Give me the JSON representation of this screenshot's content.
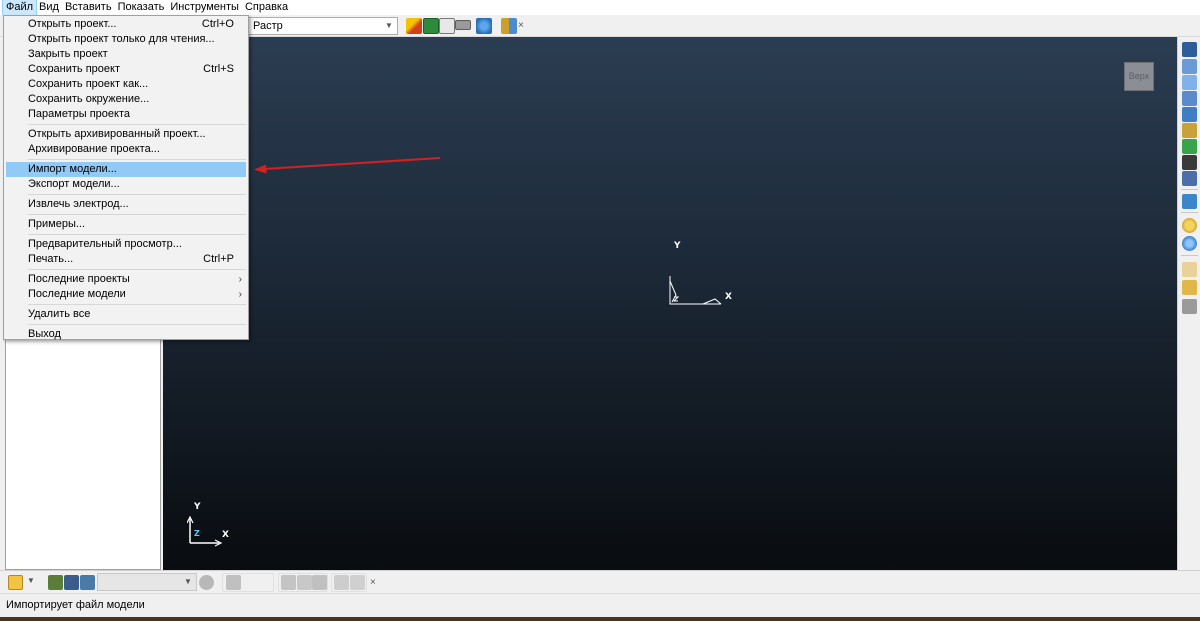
{
  "menubar": {
    "items": [
      "Файл",
      "Вид",
      "Вставить",
      "Показать",
      "Инструменты",
      "Справка"
    ]
  },
  "toolbar": {
    "display_mode": "Растр"
  },
  "viewport": {
    "view_cube_label": "Верх",
    "main_axes": {
      "x": "X",
      "y": "Y",
      "z": "Z"
    },
    "corner_axes": {
      "x": "X",
      "y": "Y",
      "z": "Z"
    }
  },
  "file_menu": {
    "groups": [
      [
        {
          "label": "Открыть проект...",
          "shortcut": "Ctrl+O"
        },
        {
          "label": "Открыть проект только для чтения..."
        },
        {
          "label": "Закрыть проект"
        },
        {
          "label": "Сохранить проект",
          "shortcut": "Ctrl+S"
        },
        {
          "label": "Сохранить проект как..."
        },
        {
          "label": "Сохранить окружение..."
        },
        {
          "label": "Параметры проекта"
        }
      ],
      [
        {
          "label": "Открыть архивированный проект..."
        },
        {
          "label": "Архивирование проекта..."
        }
      ],
      [
        {
          "label": "Импорт модели...",
          "highlighted": true
        },
        {
          "label": "Экспорт модели..."
        }
      ],
      [
        {
          "label": "Извлечь электрод..."
        }
      ],
      [
        {
          "label": "Примеры..."
        }
      ],
      [
        {
          "label": "Предварительный просмотр..."
        },
        {
          "label": "Печать...",
          "shortcut": "Ctrl+P"
        }
      ],
      [
        {
          "label": "Последние проекты",
          "submenu": true
        },
        {
          "label": "Последние модели",
          "submenu": true
        }
      ],
      [
        {
          "label": "Удалить все"
        }
      ],
      [
        {
          "label": "Выход"
        }
      ]
    ]
  },
  "statusbar": {
    "text": "Импортирует файл модели"
  },
  "colors": {
    "annotation_arrow": "#d42020",
    "menu_highlight": "#91c9f7",
    "viewport_top": "#2b3d52",
    "viewport_bottom": "#090c10"
  },
  "icons": {
    "submenu_arrow": "›",
    "close": "×",
    "combo_arrow": "chevron-down-icon"
  }
}
